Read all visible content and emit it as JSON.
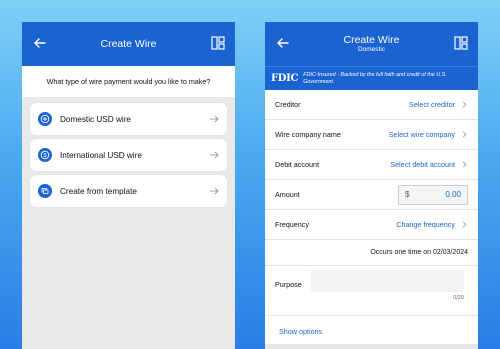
{
  "left_screen": {
    "appbar": {
      "title": "Create Wire"
    },
    "question": "What type of wire payment would you like to make?",
    "options": [
      {
        "label": "Domestic USD wire",
        "icon": "plus-circle-icon"
      },
      {
        "label": "International USD wire",
        "icon": "dollar-circle-icon"
      },
      {
        "label": "Create from template",
        "icon": "template-icon"
      }
    ]
  },
  "right_screen": {
    "appbar": {
      "title": "Create Wire",
      "subtitle": "Domestic"
    },
    "fdic": {
      "logo": "FDIC",
      "text": "FDIC-Insured - Backed by the full faith and credit of the U.S. Government."
    },
    "rows": {
      "creditor": {
        "label": "Creditor",
        "value": "Select creditor"
      },
      "wire_company": {
        "label": "Wire company name",
        "value": "Select wire company"
      },
      "debit_account": {
        "label": "Debit account",
        "value": "Select debit account"
      },
      "amount": {
        "label": "Amount",
        "currency": "$",
        "value": "0.00"
      },
      "frequency": {
        "label": "Frequency",
        "value": "Change frequency"
      }
    },
    "occurs": "Occurs one time on 02/03/2024",
    "purpose": {
      "label": "Purpose",
      "counter": "0/20"
    },
    "show_options": "Show options"
  },
  "colors": {
    "primary": "#1a63d1",
    "background_top": "#7fd0f7",
    "background_bottom": "#2a7ee6"
  }
}
